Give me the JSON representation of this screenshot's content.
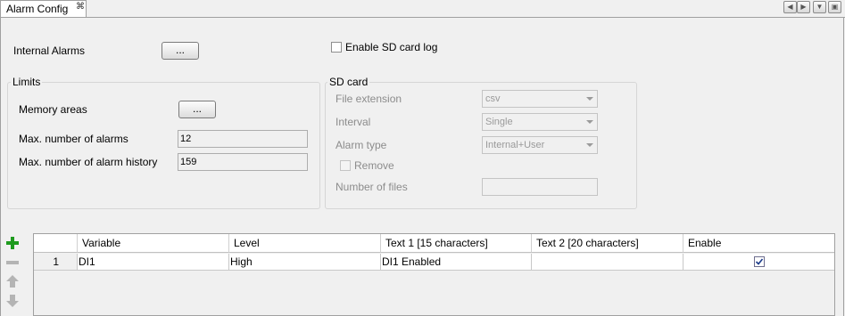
{
  "tab": {
    "title": "Alarm Config",
    "close_glyph": "⌘"
  },
  "internal_alarms": {
    "label": "Internal Alarms",
    "button": "..."
  },
  "sd_log": {
    "label": "Enable SD card log",
    "checked": false
  },
  "limits": {
    "title": "Limits",
    "memory_areas_label": "Memory areas",
    "memory_areas_button": "...",
    "max_alarms_label": "Max. number of alarms",
    "max_alarms_value": "12",
    "max_history_label": "Max. number of alarm history",
    "max_history_value": "159"
  },
  "sd_card": {
    "title": "SD card",
    "file_extension_label": "File extension",
    "file_extension_value": "csv",
    "interval_label": "Interval",
    "interval_value": "Single",
    "alarm_type_label": "Alarm type",
    "alarm_type_value": "Internal+User",
    "remove_label": "Remove",
    "number_of_files_label": "Number of files",
    "number_of_files_value": ""
  },
  "grid": {
    "columns": [
      "Variable",
      "Level",
      "Text 1 [15 characters]",
      "Text 2 [20 characters]",
      "Enable"
    ],
    "rows": [
      {
        "num": "1",
        "variable": "DI1",
        "level": "High",
        "text1": "DI1 Enabled",
        "text2": "",
        "enable": true
      }
    ]
  },
  "colors": {
    "add": "#1e9a1e",
    "disabled_icon": "#b4b4b4"
  }
}
